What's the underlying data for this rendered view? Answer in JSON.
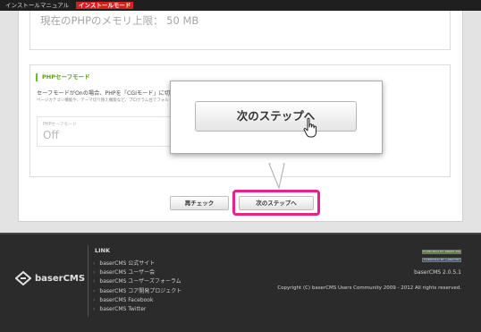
{
  "topbar": {
    "manual_label": "インストールマニュアル",
    "mode_label": "インストールモード"
  },
  "memory": {
    "text": "現在のPHPのメモリ上限：  50 MB"
  },
  "safemode_section": {
    "title": "PHPセーフモード",
    "description": "セーフモードがOnの場合、PHPを「CGIモード」に切り替えな",
    "note": "ページカテゴリ機能や、テーマ切り替え機能など、プログラム台でフォル",
    "setting_label": "PHPセーフモード",
    "setting_value": "Off"
  },
  "buttons": {
    "recheck_label": "再チェック",
    "next_label": "次のステップへ"
  },
  "popup": {
    "zoom_label": "次のステップへ"
  },
  "footer": {
    "logo_text": "baserCMS",
    "link_title": "LINK",
    "links": [
      "baserCMS 公式サイト",
      "baserCMS ユーザー会",
      "baserCMS ユーザーズフォーラム",
      "baserCMS コア開発プロジェクト",
      "baserCMS Facebook",
      "baserCMS Twitter"
    ],
    "badge1": "POWERED BY baserCMS",
    "badge2": "POWERED BY CAKEPHP",
    "version": "baserCMS 2.0.5.1",
    "copyright": "Copyright (C) baserCMS Users Community 2009 - 2012 All rights reserved."
  },
  "colors": {
    "highlight": "#e9218d",
    "mode_badge": "#d61f1f",
    "section_accent": "#6cbd22"
  }
}
